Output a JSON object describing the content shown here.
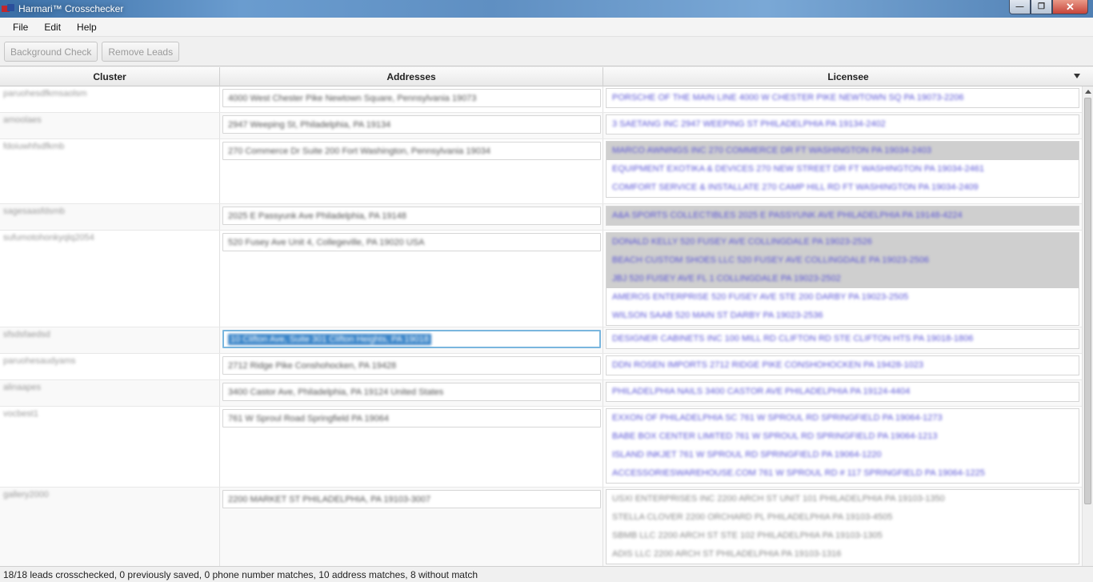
{
  "window": {
    "title": "Harmari™ Crosschecker",
    "minimize": "—",
    "maximize": "❐",
    "close": "✕"
  },
  "menu": {
    "file": "File",
    "edit": "Edit",
    "help": "Help"
  },
  "toolbar": {
    "background_check": "Background Check",
    "remove_leads": "Remove Leads"
  },
  "table": {
    "headers": {
      "cluster": "Cluster",
      "addresses": "Addresses",
      "licensee": "Licensee"
    },
    "rows": [
      {
        "cluster": "paruohesdfkmsaolsm",
        "address": "4000 West Chester Pike Newtown Square, Pennsylvania 19073",
        "licensees": [
          "PORSCHE OF THE MAIN LINE 4000 W CHESTER PIKE NEWTOWN SQ PA 19073-2206"
        ]
      },
      {
        "cluster": "amoolaes",
        "address": "2947 Weeping St, Philadelphia, PA 19134",
        "licensees": [
          "3 SAETANG INC 2947 WEEPING ST PHILADELPHIA PA 19134-2402"
        ]
      },
      {
        "cluster": "fdoiuwhfsdfkmb",
        "address": "270 Commerce Dr Suite 200 Fort Washington, Pennsylvania 19034",
        "licensees": [
          "MARCO AWNINGS INC 270 COMMERCE DR FT WASHINGTON PA 19034-2403",
          "EQUIPMENT EXOTIKA & DEVICES 270 NEW STREET DR FT WASHINGTON PA 19034-2461",
          "COMFORT SERVICE & INSTALLATE 270 CAMP HILL RD FT WASHINGTON PA 19034-2409"
        ]
      },
      {
        "cluster": "sagesaasfdsmb",
        "address": "2025 E Passyunk Ave Philadelphia, PA 19148",
        "licensees": [
          "A&A SPORTS COLLECTIBLES 2025 E PASSYUNK AVE PHILADELPHIA PA 19148-4224"
        ]
      },
      {
        "cluster": "sufumotohonkyqlq2054",
        "address": "520 Fusey Ave Unit 4, Collegeville, PA 19020 USA",
        "licensees": [
          "DONALD KELLY 520 FUSEY AVE COLLINGDALE PA 19023-2526",
          "BEACH CUSTOM SHOES LLC 520 FUSEY AVE COLLINGDALE PA 19023-2506",
          "JBJ 520 FUSEY AVE FL 1 COLLINGDALE PA 19023-2502",
          "AMEROS ENTERPRISE 520 FUSEY AVE STE 200 DARBY PA 19023-2505",
          "WILSON SAAB 520 MAIN ST DARBY PA 19023-2536"
        ]
      },
      {
        "cluster": "sfsdsfaedsd",
        "address": "10 Clifton Ave, Suite 301 Clifton Heights, PA 19018",
        "licensees": [
          "DESIGNER CABINETS INC 100 MILL RD CLIFTON RD STE CLIFTON HTS PA 19018-1806"
        ]
      },
      {
        "cluster": "paruohesaudyams",
        "address": "2712 Ridge Pike Conshohocken, PA 19428",
        "licensees": [
          "DDN ROSEN IMPORTS 2712 RIDGE PIKE CONSHOHOCKEN PA 19428-1023"
        ]
      },
      {
        "cluster": "alinaapes",
        "address": "3400 Castor Ave, Philadelphia, PA 19124 United States",
        "licensees": [
          "PHILADELPHIA NAILS 3400 CASTOR AVE PHILADELPHIA PA 19124-4404"
        ]
      },
      {
        "cluster": "vocbest1",
        "address": "761 W Sproul Road Springfield PA 19064",
        "licensees": [
          "EXXON OF PHILADELPHIA SC 761 W SPROUL RD SPRINGFIELD PA 19064-1273",
          "BABE BOX CENTER LIMITED 761 W SPROUL RD SPRINGFIELD PA 19064-1213",
          "ISLAND INKJET 761 W SPROUL RD SPRINGFIELD PA 19064-1220",
          "ACCESSORIESWAREHOUSE.COM 761 W SPROUL RD # 117 SPRINGFIELD PA 19064-1225"
        ]
      },
      {
        "cluster": "gallery2000",
        "address": "2200 MARKET ST PHILADELPHIA, PA 19103-3007",
        "licensees": [
          "USXI ENTERPRISES INC 2200 ARCH ST UNIT 101 PHILADELPHIA PA 19103-1350",
          "STELLA CLOVER 2200 ORCHARD PL PHILADELPHIA PA 19103-4505",
          "SBMB LLC 2200 ARCH ST STE 102 PHILADELPHIA PA 19103-1305",
          "ADIS LLC 2200 ARCH ST PHILADELPHIA PA 19103-1316"
        ]
      }
    ]
  },
  "status": {
    "text": "18/18 leads crosschecked, 0 previously saved, 0 phone number matches, 10 address matches, 8 without match"
  }
}
